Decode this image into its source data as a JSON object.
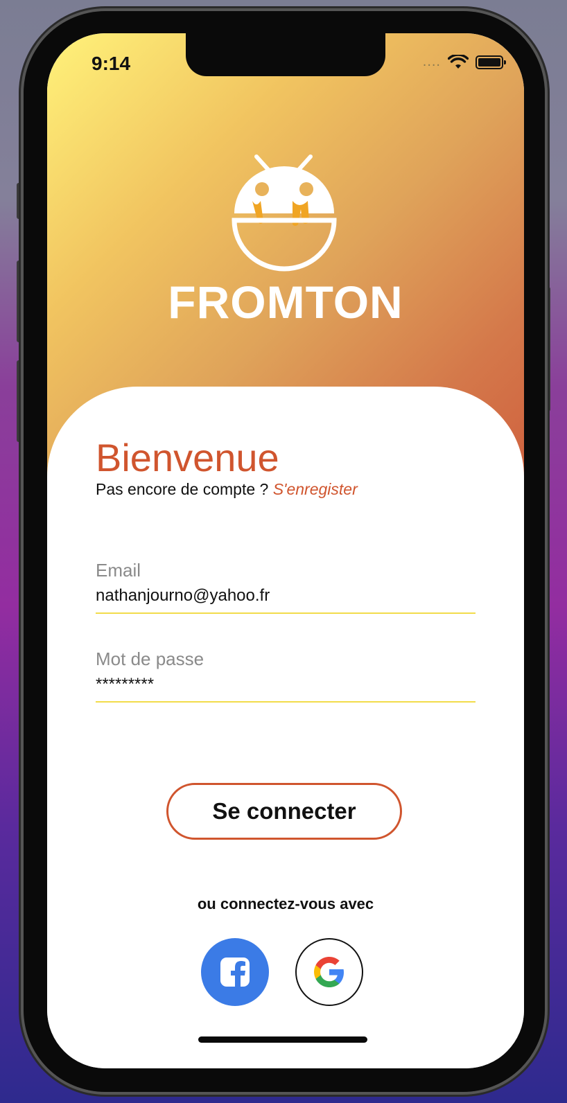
{
  "status_bar": {
    "time": "9:14",
    "signal_dots": "....",
    "wifi_icon": "wifi-icon",
    "battery_icon": "battery-icon"
  },
  "hero": {
    "brand": "FROMTON",
    "logo_icon": "fromton-logo-icon"
  },
  "login": {
    "title": "Bienvenue",
    "prompt": "Pas encore de compte ? ",
    "register_link": "S'enregister",
    "email_label": "Email",
    "email_value": "nathanjourno@yahoo.fr",
    "password_label": "Mot de passe",
    "password_value": "*********",
    "submit_label": "Se connecter",
    "alt_label": "ou connectez-vous avec"
  },
  "social": [
    {
      "name": "facebook",
      "icon": "facebook-icon",
      "color": "#3b7be6"
    },
    {
      "name": "google",
      "icon": "google-icon"
    }
  ],
  "colors": {
    "accent": "#d0552e",
    "field_underline": "#f2dc4a"
  }
}
